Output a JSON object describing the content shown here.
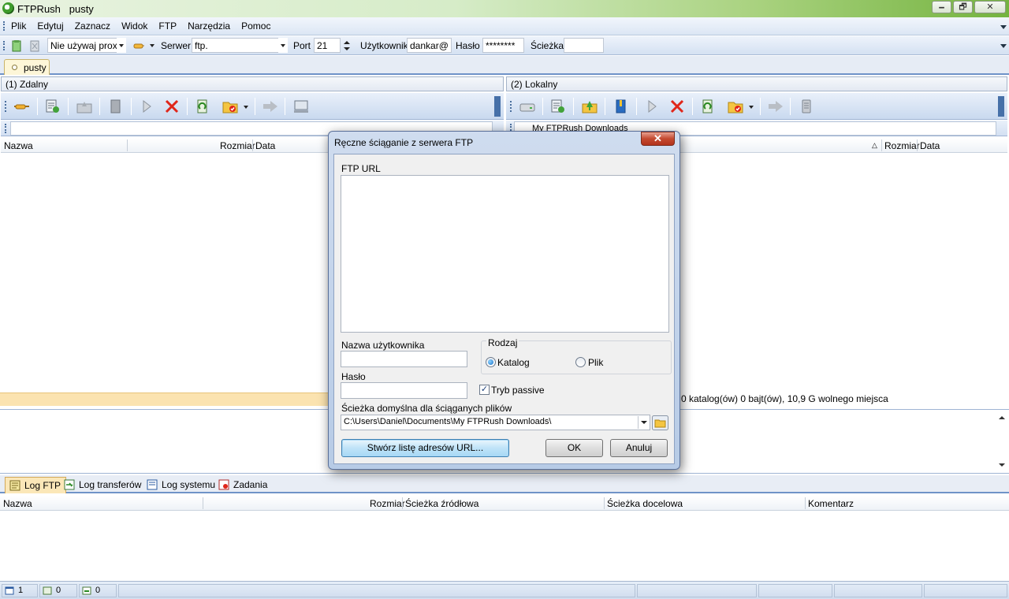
{
  "window": {
    "title": "FTPRush   pusty",
    "min": "🗕",
    "max": "🗗",
    "close": "✕"
  },
  "menu": [
    "Plik",
    "Edytuj",
    "Zaznacz",
    "Widok",
    "FTP",
    "Narzędzia",
    "Pomoc"
  ],
  "connection": {
    "proxy": "Nie używaj proxy",
    "server_label": "Serwer",
    "server_value": "ftp.",
    "port_label": "Port",
    "port_value": "21",
    "user_label": "Użytkownik",
    "user_value": "dankar@",
    "password_label": "Hasło",
    "password_value": "********",
    "path_label": "Ścieżka",
    "path_value": ""
  },
  "session_tab": "pusty",
  "remote": {
    "header": "(1) Zdalny",
    "col_name": "Nazwa",
    "col_size": "Rozmiar",
    "col_date": "Data"
  },
  "local": {
    "header": "(2) Lokalny",
    "path": "My FTPRush Downloads",
    "col_size": "Rozmiar",
    "col_date": "Data",
    "status": "0 katalog(ów) 0 bajt(ów), 10,9 G wolnego miejsca"
  },
  "log_tabs": [
    "Log FTP",
    "Log transferów",
    "Log systemu",
    "Zadania"
  ],
  "queue_columns": [
    "Nazwa",
    "Rozmiar",
    "Ścieżka źródłowa",
    "Ścieżka docelowa",
    "Komentarz"
  ],
  "statusbar": [
    "1",
    "0",
    "0"
  ],
  "dialog": {
    "title": "Ręczne ściąganie z serwera FTP",
    "url_label": "FTP URL",
    "user_label": "Nazwa użytkownika",
    "password_label": "Hasło",
    "type_label": "Rodzaj",
    "option_dir": "Katalog",
    "option_file": "Plik",
    "passive_label": "Tryb passive",
    "path_label": "Ścieżka domyślna dla ściąganych plików",
    "path_value": "C:\\Users\\Daniel\\Documents\\My FTPRush Downloads\\",
    "create_list_button": "Stwórz listę adresów URL...",
    "ok_button": "OK",
    "cancel_button": "Anuluj"
  }
}
